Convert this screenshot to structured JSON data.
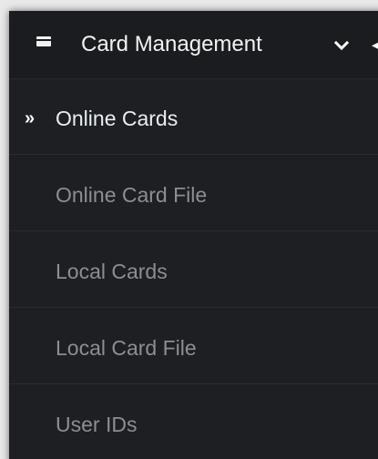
{
  "header": {
    "title": "Card Management",
    "icon": "credit-card-icon",
    "expand_icon": "chevron-down-icon",
    "secondary_icon": "collapse-icon"
  },
  "menu": {
    "items": [
      {
        "label": "Online Cards",
        "active": true,
        "marker": "»"
      },
      {
        "label": "Online Card File",
        "active": false
      },
      {
        "label": "Local Cards",
        "active": false
      },
      {
        "label": "Local Card File",
        "active": false
      },
      {
        "label": "User IDs",
        "active": false
      }
    ]
  },
  "colors": {
    "panel_background": "#1d1f22",
    "header_background": "#1a1c1f",
    "active_text": "#e9edf2",
    "inactive_text": "#8c8e91",
    "divider": "#2a2d31"
  }
}
